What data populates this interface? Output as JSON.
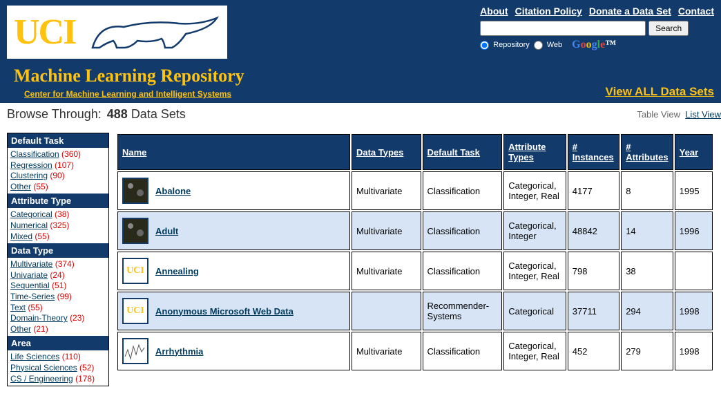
{
  "topLinks": [
    "About",
    "Citation Policy",
    "Donate a Data Set",
    "Contact"
  ],
  "search": {
    "button": "Search",
    "radio1": "Repository",
    "radio2": "Web",
    "placeholder": ""
  },
  "logoText": "UCI",
  "siteTitle": "Machine Learning Repository",
  "siteSub": "Center for Machine Learning and Intelligent Systems",
  "viewAll": "View ALL Data Sets",
  "browse": {
    "label": "Browse Through:",
    "count": "488",
    "suffix": "Data Sets"
  },
  "viewToggle": {
    "table": "Table View",
    "list": "List View"
  },
  "sidebar": [
    {
      "title": "Default Task",
      "items": [
        {
          "label": "Classification",
          "count": "(360)"
        },
        {
          "label": "Regression",
          "count": "(107)"
        },
        {
          "label": "Clustering",
          "count": "(90)"
        },
        {
          "label": "Other",
          "count": "(55)"
        }
      ]
    },
    {
      "title": "Attribute Type",
      "items": [
        {
          "label": "Categorical",
          "count": "(38)"
        },
        {
          "label": "Numerical",
          "count": "(325)"
        },
        {
          "label": "Mixed",
          "count": "(55)"
        }
      ]
    },
    {
      "title": "Data Type",
      "items": [
        {
          "label": "Multivariate",
          "count": "(374)"
        },
        {
          "label": "Univariate",
          "count": "(24)"
        },
        {
          "label": "Sequential",
          "count": "(51)"
        },
        {
          "label": "Time-Series",
          "count": "(99)"
        },
        {
          "label": "Text",
          "count": "(55)"
        },
        {
          "label": "Domain-Theory",
          "count": "(23)"
        },
        {
          "label": "Other",
          "count": "(21)"
        }
      ]
    },
    {
      "title": "Area",
      "items": [
        {
          "label": "Life Sciences",
          "count": "(110)"
        },
        {
          "label": "Physical Sciences",
          "count": "(52)"
        },
        {
          "label": "CS / Engineering",
          "count": "(178)"
        }
      ]
    }
  ],
  "columns": [
    "Name",
    "Data Types",
    "Default Task",
    "Attribute Types",
    "# Instances",
    "# Attributes",
    "Year"
  ],
  "rows": [
    {
      "name": "Abalone",
      "dt": "Multivariate",
      "task": "Classification",
      "attr": "Categorical, Integer, Real",
      "inst": "4177",
      "natt": "8",
      "year": "1995",
      "thumb": "img"
    },
    {
      "name": "Adult",
      "dt": "Multivariate",
      "task": "Classification",
      "attr": "Categorical, Integer",
      "inst": "48842",
      "natt": "14",
      "year": "1996",
      "thumb": "img"
    },
    {
      "name": "Annealing",
      "dt": "Multivariate",
      "task": "Classification",
      "attr": "Categorical, Integer, Real",
      "inst": "798",
      "natt": "38",
      "year": "",
      "thumb": "uci"
    },
    {
      "name": "Anonymous Microsoft Web Data",
      "dt": "",
      "task": "Recommender-Systems",
      "attr": "Categorical",
      "inst": "37711",
      "natt": "294",
      "year": "1998",
      "thumb": "uci"
    },
    {
      "name": "Arrhythmia",
      "dt": "Multivariate",
      "task": "Classification",
      "attr": "Categorical, Integer, Real",
      "inst": "452",
      "natt": "279",
      "year": "1998",
      "thumb": "graph"
    }
  ]
}
